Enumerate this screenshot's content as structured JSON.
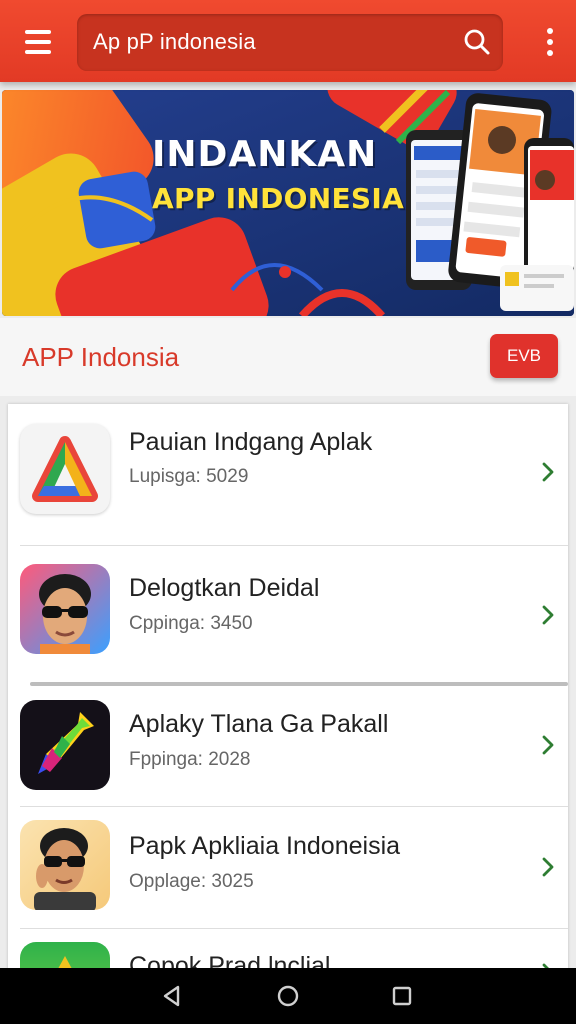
{
  "search": {
    "query": "Ap pP indonesia"
  },
  "banner": {
    "headline": "INDANKAN",
    "subheadline": "APP INDONESIA"
  },
  "section": {
    "title": "APP Indonsia",
    "button_label": "EVB"
  },
  "apps": [
    {
      "name": "Pauian Indgang Aplak",
      "meta": "Lupisga: 5029",
      "icon": "colorful-triangle-icon"
    },
    {
      "name": "Delogtkan Deidal",
      "meta": "Cppinga: 3450",
      "icon": "avatar-sunglasses-icon"
    },
    {
      "name": "Aplaky Tlanа Ga Pakall",
      "meta": "Fppinga: 2028",
      "icon": "rainbow-arrow-icon"
    },
    {
      "name": "Papk Apkliaia Indoneisia",
      "meta": "Opplage: 3025",
      "icon": "avatar-sunglasses-icon"
    },
    {
      "name": "Copok Prad lnclial",
      "meta": "",
      "icon": "colorful-triangle-icon"
    }
  ],
  "colors": {
    "appbar": "#e83f29",
    "accent": "#e0322c",
    "chevron": "#2e7d32",
    "banner_sub": "#ffe23a"
  }
}
